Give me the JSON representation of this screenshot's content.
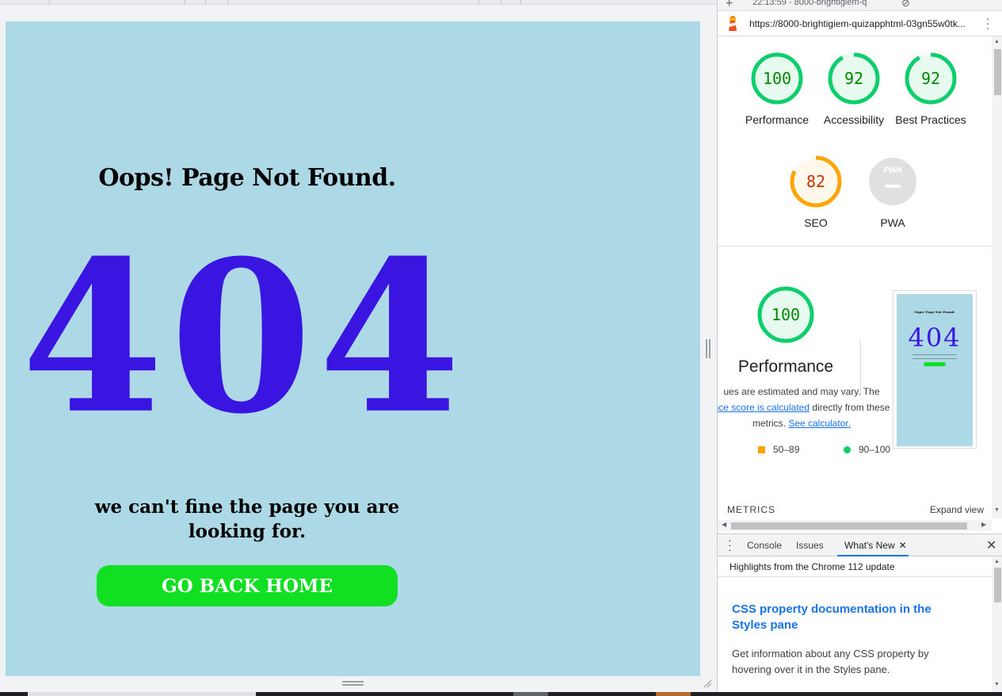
{
  "page": {
    "heading": "Oops! Page Not Found.",
    "code": "404",
    "message": "we can't fine the page you are looking for.",
    "button_label": "GO BACK HOME",
    "background_color": "#add8e6",
    "code_color": "#3a14e0",
    "button_color": "#11e022"
  },
  "devtools": {
    "report_time": "22:13:59 - 8000-brightigiem-q",
    "url": "https://8000-brightigiem-quizapphtml-03gn55w0tk...",
    "scores": [
      {
        "label": "Performance",
        "score": "100",
        "value": 100,
        "status": "pass"
      },
      {
        "label": "Accessibility",
        "score": "92",
        "value": 92,
        "status": "pass"
      },
      {
        "label": "Best Practices",
        "score": "92",
        "value": 92,
        "status": "pass"
      },
      {
        "label": "SEO",
        "score": "82",
        "value": 82,
        "status": "average"
      },
      {
        "label": "PWA",
        "score": "",
        "value": null,
        "status": "na"
      }
    ],
    "pwa_badge_text": "PWA",
    "performance": {
      "score": "100",
      "value": 100,
      "title": "Performance",
      "desc_part1": "ues are estimated and may vary. The",
      "desc_link1": "nce score is calculated",
      "desc_part2": " directly from these metrics.",
      "desc_link2": "See calculator.",
      "legend_avg": "50–89",
      "legend_pass": "90–100"
    },
    "thumbnail": {
      "heading": "Oops! Page Not Found.",
      "code": "404"
    },
    "metrics_label": "METRICS",
    "expand_label": "Expand view",
    "drawer_tabs": [
      "Console",
      "Issues",
      "What's New"
    ],
    "highlights_label": "Highlights from the Chrome 112 update",
    "whats_new_title": "CSS property documentation in the Styles pane",
    "whats_new_desc": "Get information about any CSS property by hovering over it in the Styles pane.",
    "colors": {
      "pass": "#0cce6b",
      "average": "#ffa400",
      "link": "#1a73e8"
    }
  }
}
